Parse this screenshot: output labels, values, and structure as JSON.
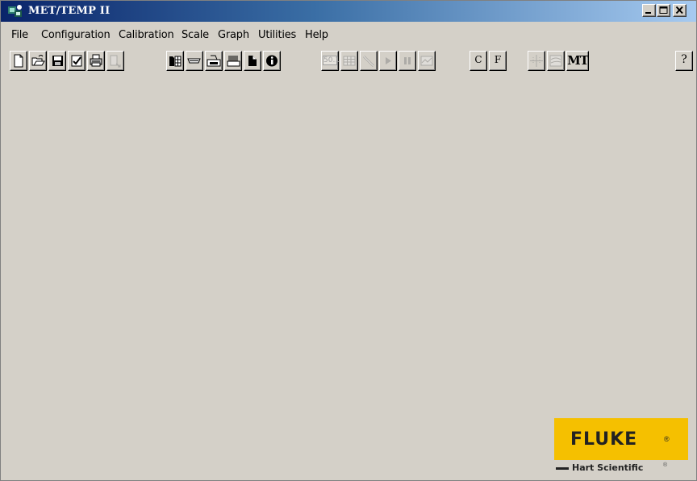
{
  "window": {
    "title": "MET/TEMP II",
    "controls": [
      "minimize-icon",
      "maximize-icon",
      "close-icon"
    ]
  },
  "menu": [
    "File",
    "Configuration",
    "Calibration",
    "Scale",
    "Graph",
    "Utilities",
    "Help"
  ],
  "toolbar": {
    "groups": [
      [
        "new-file-icon",
        "open-folder-icon",
        "save-disk-icon",
        "checkmark-icon",
        "printer-icon",
        "export-icon"
      ],
      [
        "instrument-setup-icon",
        "probe-icon",
        "scanner-icon",
        "bath-icon",
        "document-icon",
        "info-icon"
      ],
      [
        "readout-icon",
        "table-icon",
        "probe-disabled-icon",
        "play-icon",
        "pause-icon",
        "graph-icon"
      ],
      [
        "celsius-button",
        "fahrenheit-button"
      ],
      [
        "crosshair-icon",
        "chart-icon",
        "mt-button"
      ],
      [
        "help-icon"
      ]
    ],
    "readout_text": "50.1",
    "celsius_label": "C",
    "fahrenheit_label": "F",
    "mt_label": "MT",
    "help_label": "?"
  },
  "logo": {
    "brand": "FLUKE",
    "brand_dot": "®",
    "sub": "Hart Scientific",
    "sub_reg": "®",
    "color": "#f5c000"
  }
}
